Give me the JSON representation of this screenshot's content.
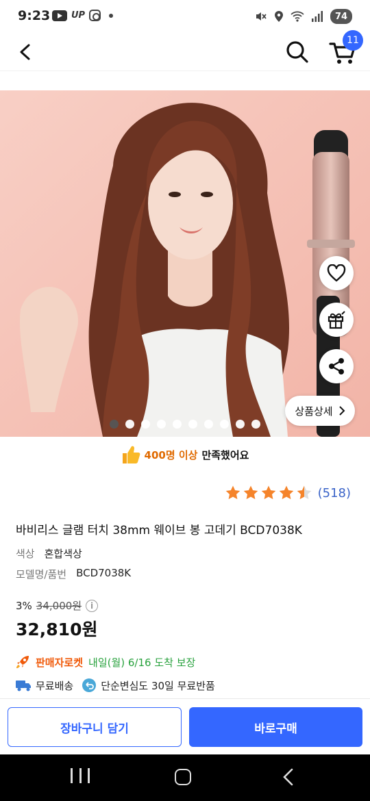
{
  "status_bar": {
    "time": "9:23",
    "left_icons": [
      "youtube-icon",
      "up-icon",
      "instagram-icon",
      "dot-icon"
    ],
    "up_text": "UP",
    "right_icons": [
      "mute-icon",
      "location-icon",
      "wifi-icon",
      "signal-icon"
    ],
    "battery": "74"
  },
  "header": {
    "back_icon": "chevron-left-icon",
    "search_icon": "search-icon",
    "cart_icon": "cart-icon",
    "cart_count": "11"
  },
  "gallery": {
    "slide_count": 10,
    "active_index": 0,
    "detail_button_label": "상품상세",
    "actions": [
      "heart-icon",
      "gift-icon",
      "share-icon"
    ]
  },
  "satisfaction": {
    "highlight": "400명 이상",
    "rest": "만족했어요",
    "icon": "thumbs-up-icon"
  },
  "rating": {
    "stars": 4.5,
    "count": "(518)",
    "star_color": "#f5842b"
  },
  "product": {
    "title": "바비리스 글램 터치 38mm 웨이브 봉 고데기 BCD7038K",
    "options": [
      {
        "label": "색상",
        "value": "혼합색상"
      },
      {
        "label": "모델명/품번",
        "value": "BCD7038K"
      }
    ],
    "discount": "3%",
    "original_price": "34,000원",
    "price": "32,810원"
  },
  "delivery": {
    "rocket_label": "판매자로켓",
    "rocket_text": "내일(월) 6/16 도착 보장",
    "free_shipping": "무료배송",
    "free_return": "단순변심도 30일 무료반품"
  },
  "bottom": {
    "cart_add_label": "장바구니 담기",
    "buy_now_label": "바로구매",
    "accent_color": "#3467ff"
  }
}
